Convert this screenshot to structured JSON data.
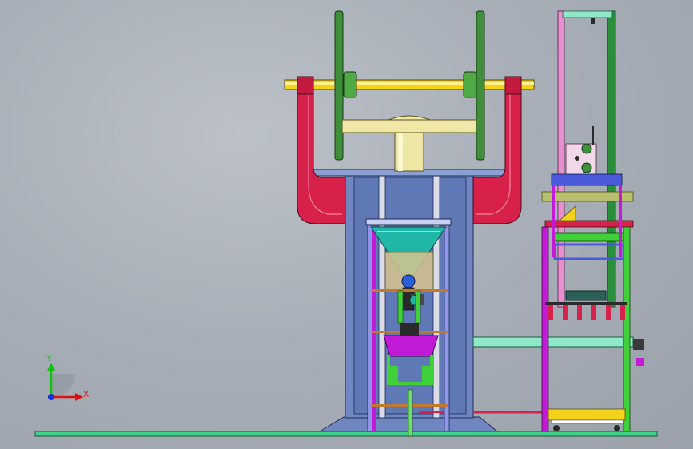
{
  "viewport": {
    "background": "#a9afb8"
  },
  "triad": {
    "x_label": "X",
    "y_label": "Y",
    "x_color": "#e01010",
    "y_color": "#10c010",
    "z_color": "#1030e0"
  },
  "colors": {
    "crank_shaft": "#f2d21a",
    "flywheel": "#3f8f3a",
    "frame_red": "#d8214a",
    "column": "#6f86c0",
    "hopper": "#1fb8a8",
    "ground_rail": "#3fd08a",
    "magenta_part": "#c21ad6",
    "cyan_rail": "#8fe8c8"
  }
}
